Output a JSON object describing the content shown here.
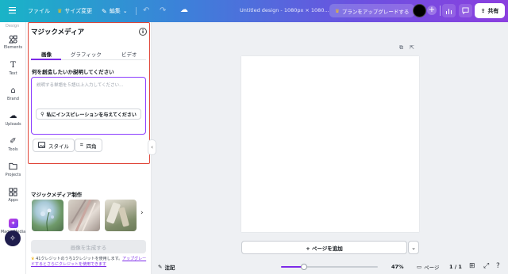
{
  "topbar": {
    "file": "ファイル",
    "resize": "サイズ変更",
    "edit": "編集",
    "title": "Untitled design - 1080px × 1080...",
    "upgrade": "プランをアップグレードする",
    "share": "共有"
  },
  "rail": {
    "top_label": "Design",
    "items": [
      {
        "label": "Elements",
        "icon": "elements-icon"
      },
      {
        "label": "Text",
        "icon": "text-icon"
      },
      {
        "label": "Brand",
        "icon": "brand-icon"
      },
      {
        "label": "Uploads",
        "icon": "uploads-icon"
      },
      {
        "label": "Tools",
        "icon": "tools-icon"
      },
      {
        "label": "Projects",
        "icon": "projects-icon"
      },
      {
        "label": "Apps",
        "icon": "apps-icon"
      },
      {
        "label": "Magic Media",
        "icon": "magic-media-icon"
      }
    ]
  },
  "panel": {
    "title": "マジックメディア",
    "tabs": [
      "画像",
      "グラフィック",
      "ビデオ"
    ],
    "active_tab": "画像",
    "prompt_label": "何を創造したいか説明してください",
    "prompt_placeholder": "説明する単語を５語以上入力してください...",
    "inspire": "私にインスピレーションを与えてください",
    "style": "スタイル",
    "aspect": "四角",
    "recent_title": "マジックメディア制作",
    "generate": "画像を生成する",
    "credits_text": "41クレジットのうち1クレジットを使用します。",
    "credits_link": "アップグレードするとさらにクレジットを使用できます"
  },
  "canvas": {
    "add_page": "+ ページを追加"
  },
  "bottombar": {
    "notes": "注記",
    "zoom_percent": 47,
    "zoom": "47%",
    "pages": "ページ",
    "page_count": "1 / 1"
  }
}
